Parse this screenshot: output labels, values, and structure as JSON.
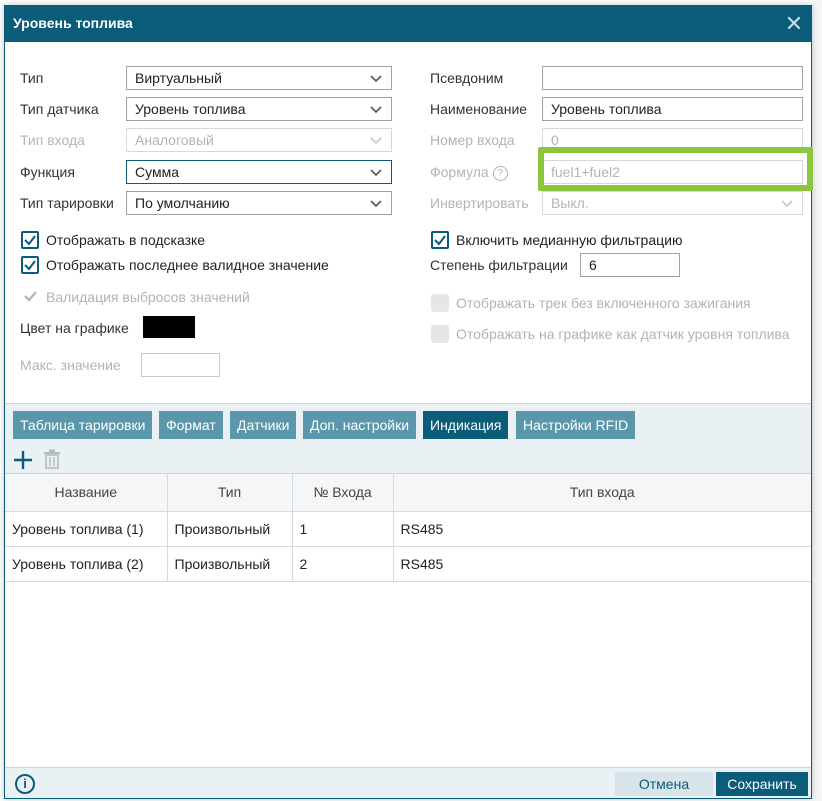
{
  "dialog": {
    "title": "Уровень топлива",
    "close_glyph": "✕"
  },
  "left": {
    "type": {
      "label": "Тип",
      "value": "Виртуальный"
    },
    "sensor_type": {
      "label": "Тип датчика",
      "value": "Уровень топлива"
    },
    "input_type": {
      "label": "Тип входа",
      "value": "Аналоговый"
    },
    "function": {
      "label": "Функция",
      "value": "Сумма"
    },
    "calibration_type": {
      "label": "Тип тарировки",
      "value": "По умолчанию"
    },
    "show_in_tooltip": "Отображать в подсказке",
    "show_last_valid": "Отображать последнее валидное значение",
    "outlier_validation": "Валидация выбросов значений",
    "chart_color_label": "Цвет на графике",
    "max_value_label": "Макс. значение"
  },
  "right": {
    "alias": {
      "label": "Псевдоним",
      "value": ""
    },
    "name": {
      "label": "Наименование",
      "value": "Уровень топлива"
    },
    "input_number": {
      "label": "Номер входа",
      "value": "0"
    },
    "formula": {
      "label": "Формула",
      "value": "fuel1+fuel2"
    },
    "invert": {
      "label": "Инвертировать",
      "value": "Выкл."
    },
    "median_filter": "Включить медианную фильтрацию",
    "filter_degree": {
      "label": "Степень фильтрации",
      "value": "6"
    },
    "track_without_ignition": "Отображать трек без включенного зажигания",
    "show_as_fuel_sensor": "Отображать на графике как датчик уровня топлива"
  },
  "tabs": [
    {
      "label": "Таблица тарировки"
    },
    {
      "label": "Формат"
    },
    {
      "label": "Датчики"
    },
    {
      "label": "Доп. настройки"
    },
    {
      "label": "Индикация"
    },
    {
      "label": "Настройки RFID"
    }
  ],
  "table": {
    "headers": [
      "Название",
      "Тип",
      "№ Входа",
      "Тип входа"
    ],
    "rows": [
      [
        "Уровень топлива (1)",
        "Произвольный",
        "1",
        "RS485"
      ],
      [
        "Уровень топлива (2)",
        "Произвольный",
        "2",
        "RS485"
      ]
    ]
  },
  "footer": {
    "cancel": "Отмена",
    "save": "Сохранить"
  },
  "colors": {
    "accent": "#0b5c78",
    "tab": "#5a97ab",
    "highlight": "#8cc63f",
    "chart_color": "#000000"
  },
  "icons": [
    "close-icon",
    "chevron-down-icon",
    "help-icon",
    "checkbox-checked-icon",
    "add-icon",
    "trash-icon",
    "info-icon"
  ]
}
